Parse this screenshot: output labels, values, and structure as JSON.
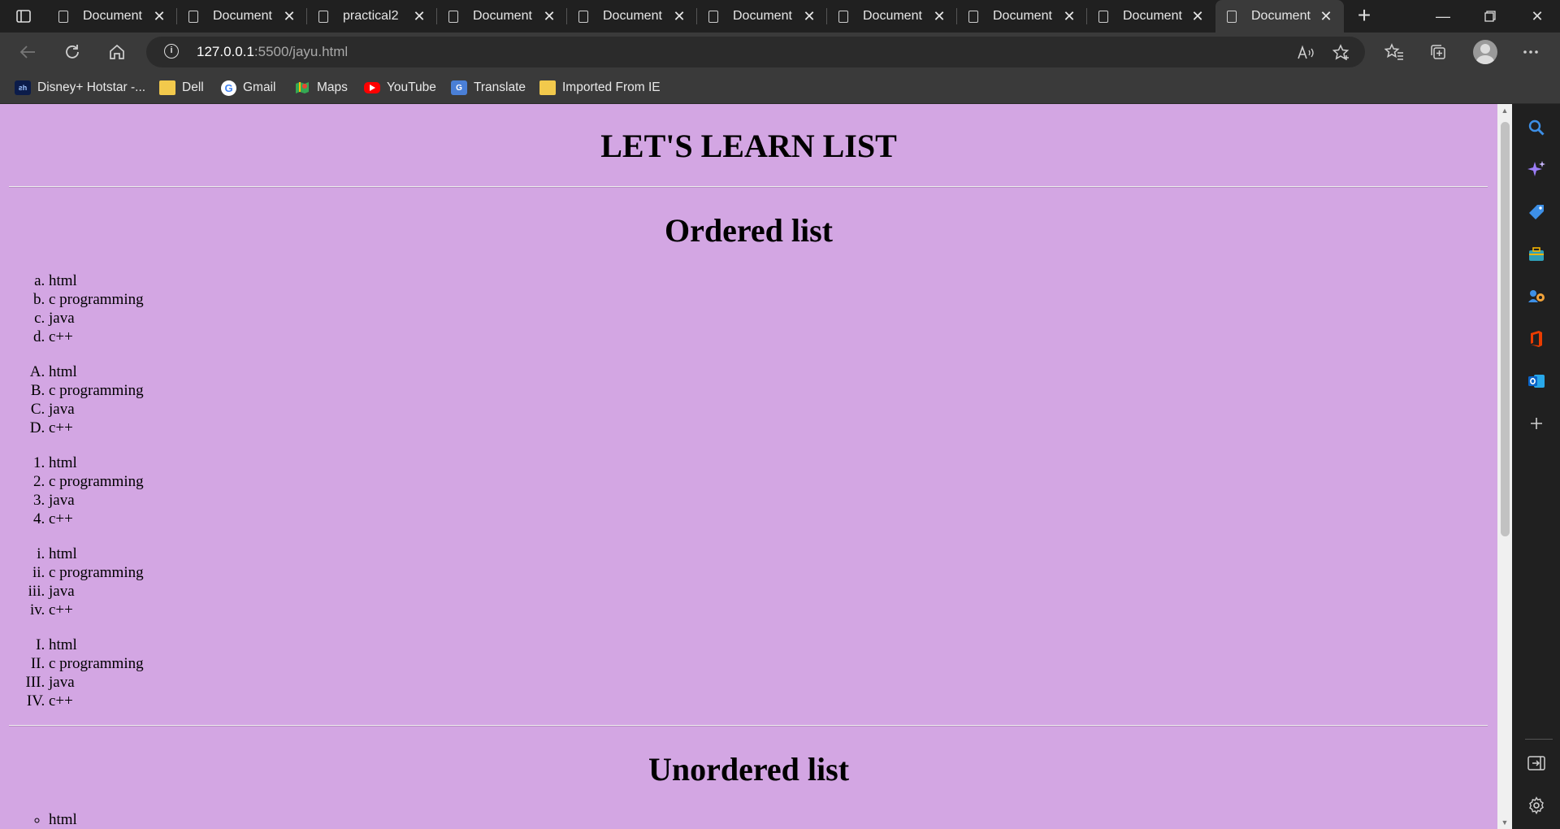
{
  "browser": {
    "tabs": [
      {
        "label": "Document"
      },
      {
        "label": "Document"
      },
      {
        "label": "practical2"
      },
      {
        "label": "Document"
      },
      {
        "label": "Document"
      },
      {
        "label": "Document"
      },
      {
        "label": "Document"
      },
      {
        "label": "Document"
      },
      {
        "label": "Document"
      },
      {
        "label": "Document",
        "active": true
      }
    ],
    "url_host": "127.0.0.1",
    "url_rest": ":5500/jayu.html",
    "bookmarks": [
      {
        "label": "Disney+ Hotstar -...",
        "icon": "hotstar-icon"
      },
      {
        "label": "Dell",
        "icon": "folder-icon"
      },
      {
        "label": "Gmail",
        "icon": "google-icon"
      },
      {
        "label": "Maps",
        "icon": "maps-icon"
      },
      {
        "label": "YouTube",
        "icon": "youtube-icon"
      },
      {
        "label": "Translate",
        "icon": "translate-icon"
      },
      {
        "label": "Imported From IE",
        "icon": "folder-icon"
      }
    ],
    "colors": {
      "page_bg": "#d3a6e3",
      "chrome_dark": "#202020",
      "chrome_mid": "#3a3a3a"
    }
  },
  "page": {
    "title": "LET'S LEARN LIST",
    "ordered_heading": "Ordered list",
    "ordered_lists": [
      {
        "type": "lower-alpha",
        "items": [
          "html",
          "c programming",
          "java",
          "c++"
        ]
      },
      {
        "type": "upper-alpha",
        "items": [
          "html",
          "c programming",
          "java",
          "c++"
        ]
      },
      {
        "type": "decimal",
        "items": [
          "html",
          "c programming",
          "java",
          "c++"
        ]
      },
      {
        "type": "lower-roman",
        "items": [
          "html",
          "c programming",
          "java",
          "c++"
        ]
      },
      {
        "type": "upper-roman",
        "items": [
          "html",
          "c programming",
          "java",
          "c++"
        ]
      }
    ],
    "unordered_heading": "Unordered list",
    "unordered_list": {
      "type": "circle",
      "items": [
        "html"
      ]
    }
  }
}
